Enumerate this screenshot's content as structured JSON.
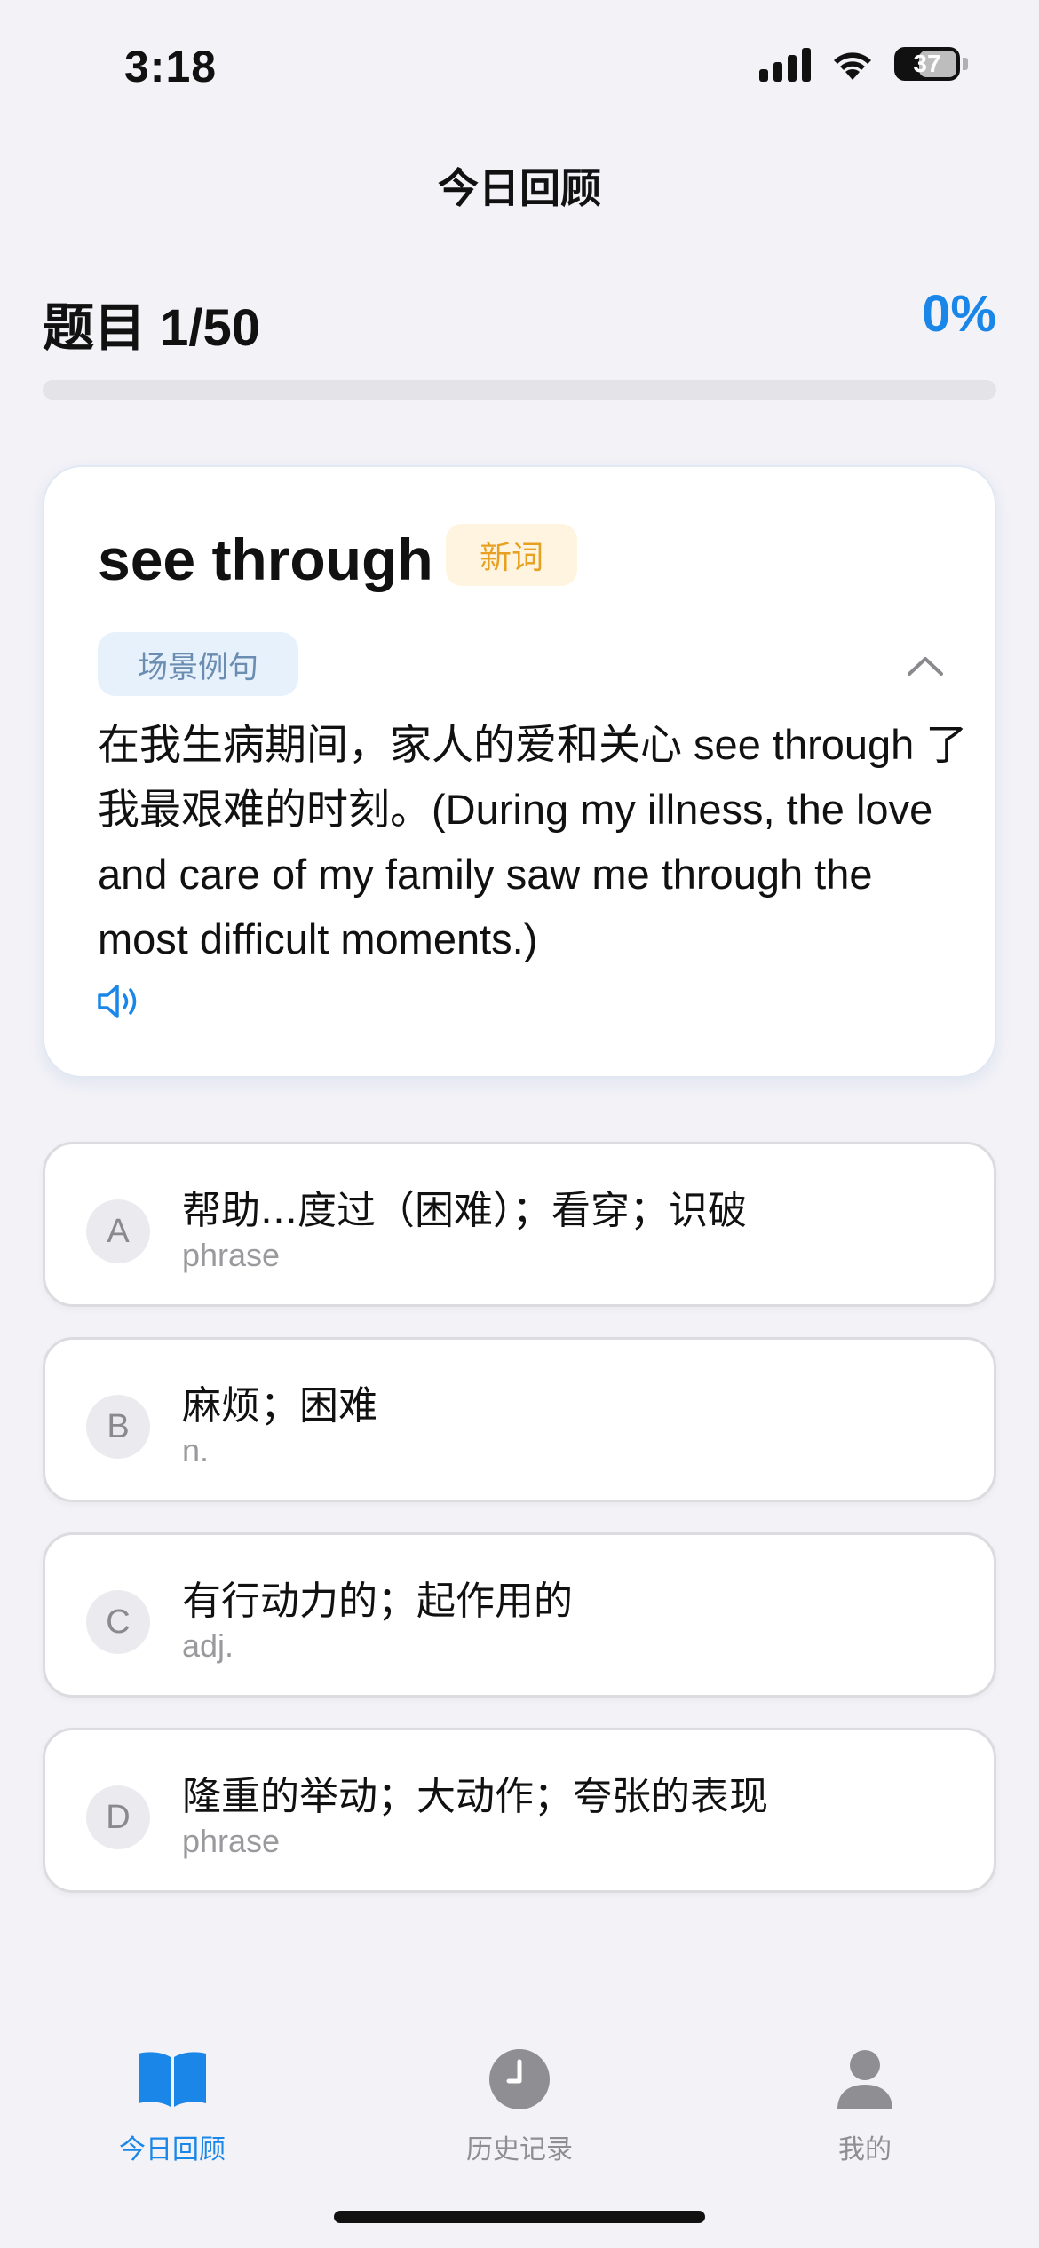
{
  "status_bar": {
    "time": "3:18",
    "battery_level": "37"
  },
  "nav": {
    "title": "今日回顾"
  },
  "progress": {
    "label": "题目 1/50",
    "percent_text": "0%",
    "fraction": 0
  },
  "word_card": {
    "word": "see through",
    "badge": "新词",
    "scene_tag": "场景例句",
    "example": "在我生病期间，家人的爱和关心 see through 了我最艰难的时刻。(During my illness, the love and care of my family saw me through the most difficult moments.)"
  },
  "options": [
    {
      "letter": "A",
      "meaning": "帮助...度过（困难）；看穿；识破",
      "pos": "phrase"
    },
    {
      "letter": "B",
      "meaning": "麻烦；困难",
      "pos": "n."
    },
    {
      "letter": "C",
      "meaning": "有行动力的；起作用的",
      "pos": "adj."
    },
    {
      "letter": "D",
      "meaning": "隆重的举动；大动作；夸张的表现",
      "pos": "phrase"
    }
  ],
  "tab_bar": {
    "tabs": [
      {
        "label": "今日回顾",
        "icon": "book-icon",
        "active": true
      },
      {
        "label": "历史记录",
        "icon": "clock-icon",
        "active": false
      },
      {
        "label": "我的",
        "icon": "person-icon",
        "active": false
      }
    ]
  },
  "colors": {
    "accent": "#1a86e8",
    "badge_text": "#e8a020",
    "badge_bg": "#fff4e0",
    "background": "#f2f2f7"
  }
}
